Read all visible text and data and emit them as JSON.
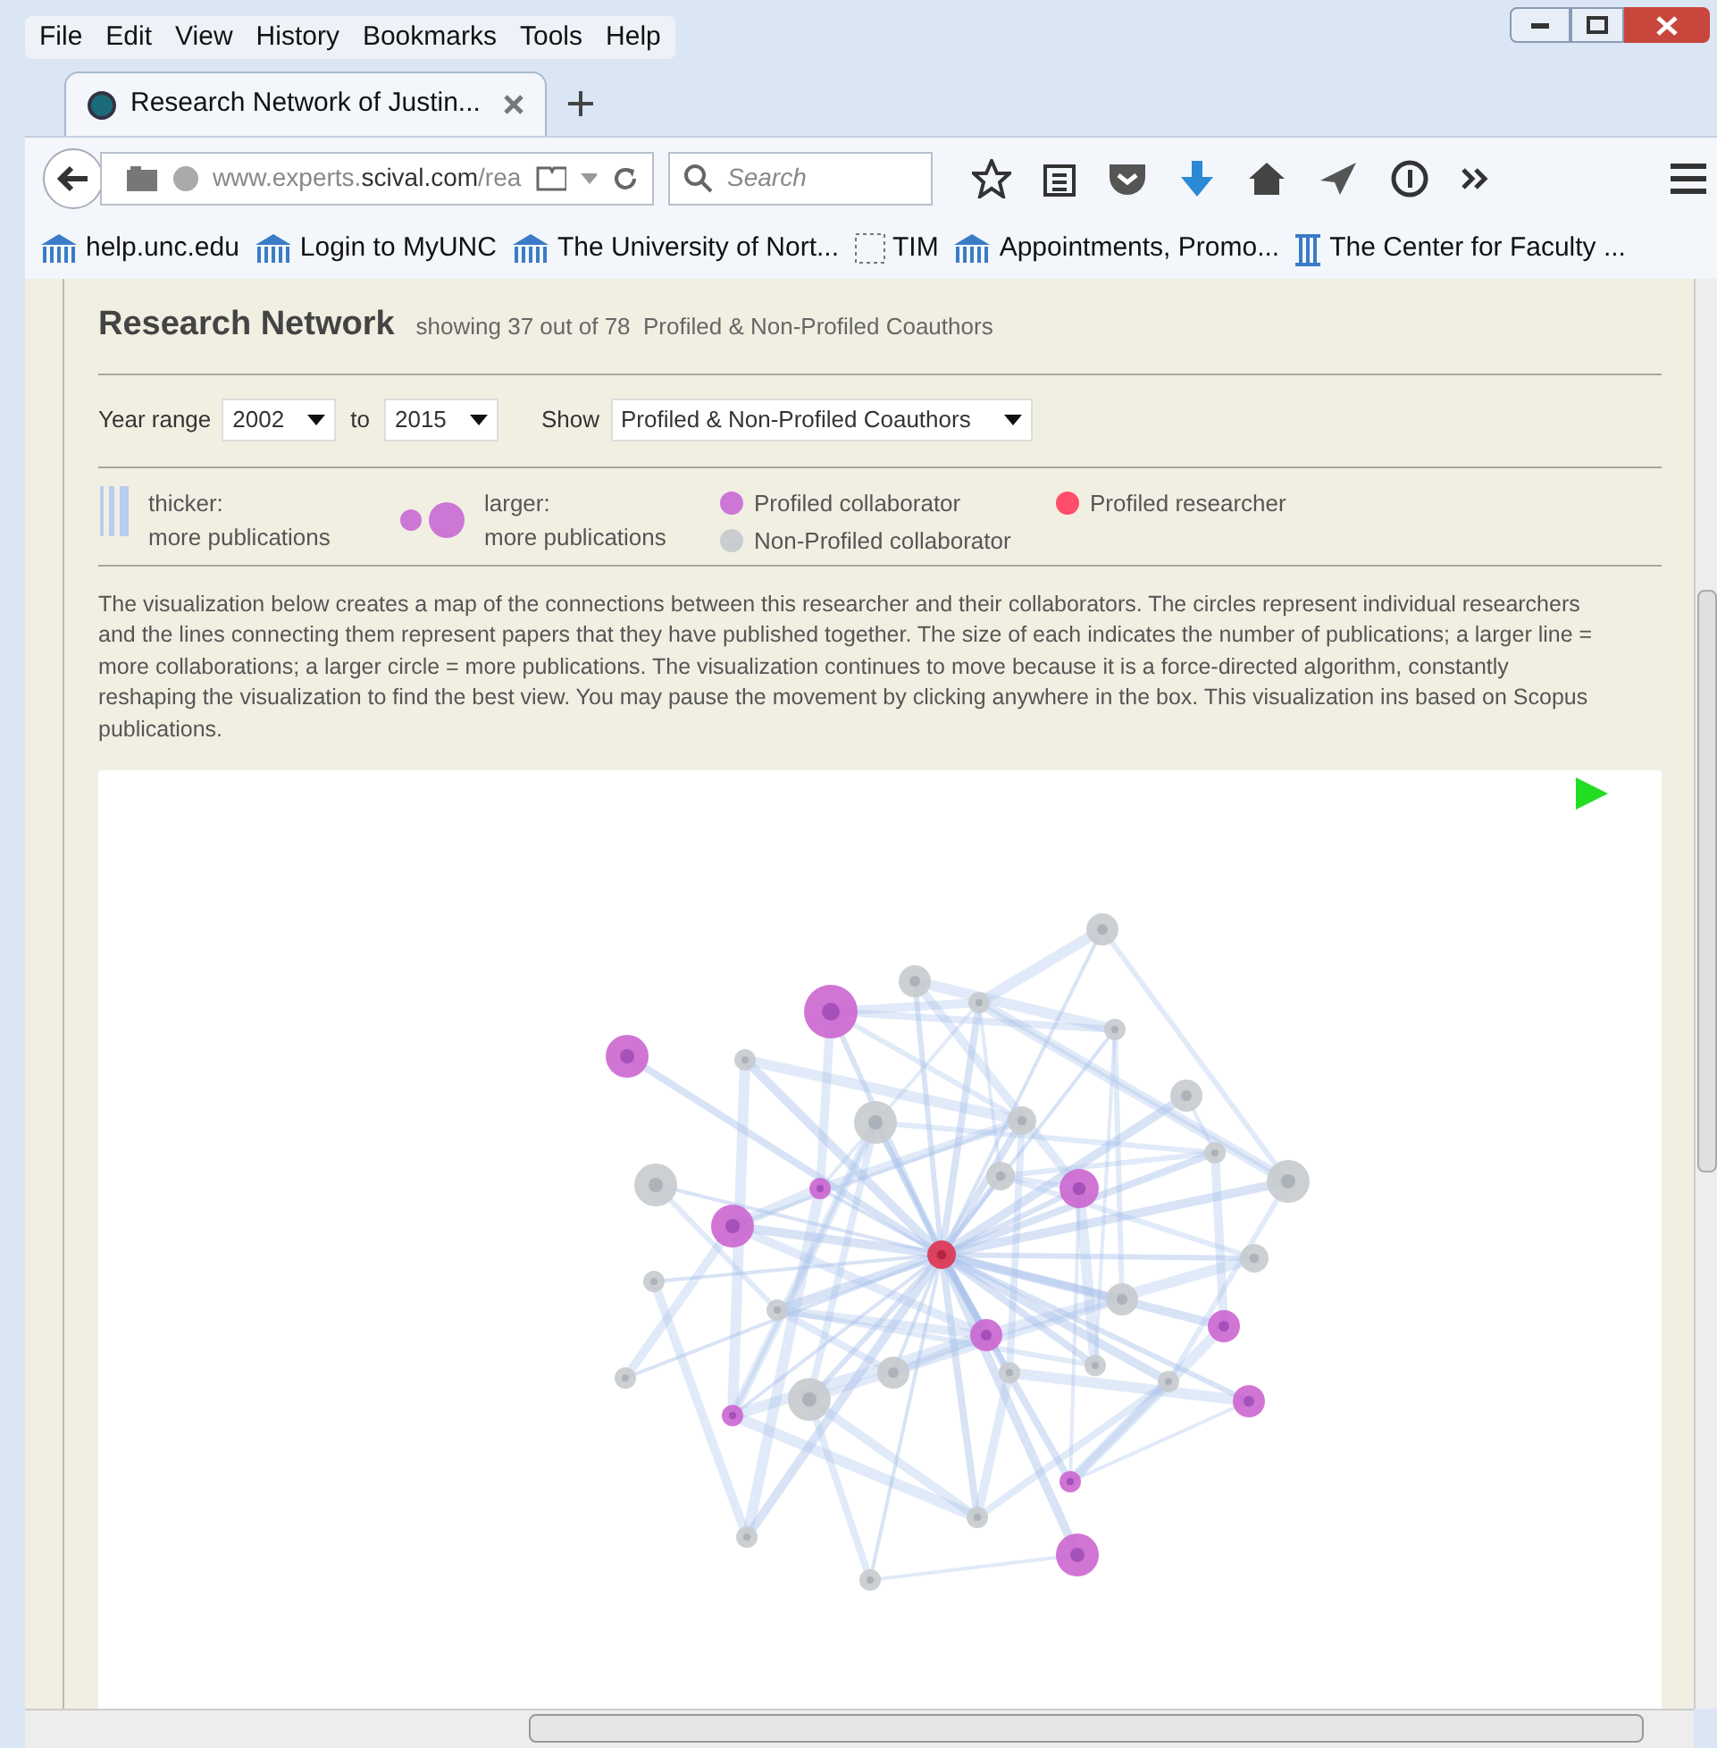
{
  "menu": [
    "File",
    "Edit",
    "View",
    "History",
    "Bookmarks",
    "Tools",
    "Help"
  ],
  "tab": {
    "title": "Research Network of Justin...",
    "selected": true
  },
  "address": {
    "url": "www.experts.**scival.com**/rea"
  },
  "search": {
    "placeholder": "Search"
  },
  "bookmarks": [
    {
      "label": "help.unc.edu",
      "kind": "site"
    },
    {
      "label": "Login to MyUNC",
      "kind": "site"
    },
    {
      "label": "The University of Nort...",
      "kind": "site"
    },
    {
      "label": "TIM",
      "kind": "blank"
    },
    {
      "label": "Appointments, Promo...",
      "kind": "site"
    },
    {
      "label": "The Center for Faculty ...",
      "kind": "column"
    }
  ],
  "page": {
    "title": "Research Network",
    "subtitle": "showing 37 out of 78  Profiled & Non-Profiled Coauthors",
    "controls": {
      "year_label": "Year range",
      "from": "2002",
      "to_label": "to",
      "to": "2015",
      "show_label": "Show",
      "show": "Profiled & Non-Profiled Coauthors"
    },
    "legend": [
      {
        "kind": "lines",
        "lines": [
          "thicker:",
          "more publications"
        ]
      },
      {
        "kind": "sizes",
        "lines": [
          "larger:",
          "more publications"
        ]
      },
      {
        "kind": "dot",
        "color": "#cc77d6",
        "lines": [
          "Profiled collaborator"
        ]
      },
      {
        "kind": "dot",
        "color": "#ff4d6b",
        "lines": [
          "Profiled researcher"
        ]
      },
      {
        "kind": "dot",
        "color": "#c9cdd0",
        "lines": [
          "Non-Profiled collaborator"
        ]
      }
    ],
    "description": "The visualization below creates a map of the connections between this researcher and their collaborators. The circles represent individual researchers and the lines connecting them represent papers that they have published together. The size of each indicates the number of publications; a larger line = more collaborations; a larger circle = more publications. The visualization continues to move because it is a force-directed algorithm, constantly reshaping the visualization to find the best view. You may pause the movement by clicking anywhere in the box. This visualization ins based on Scopus publications."
  }
}
